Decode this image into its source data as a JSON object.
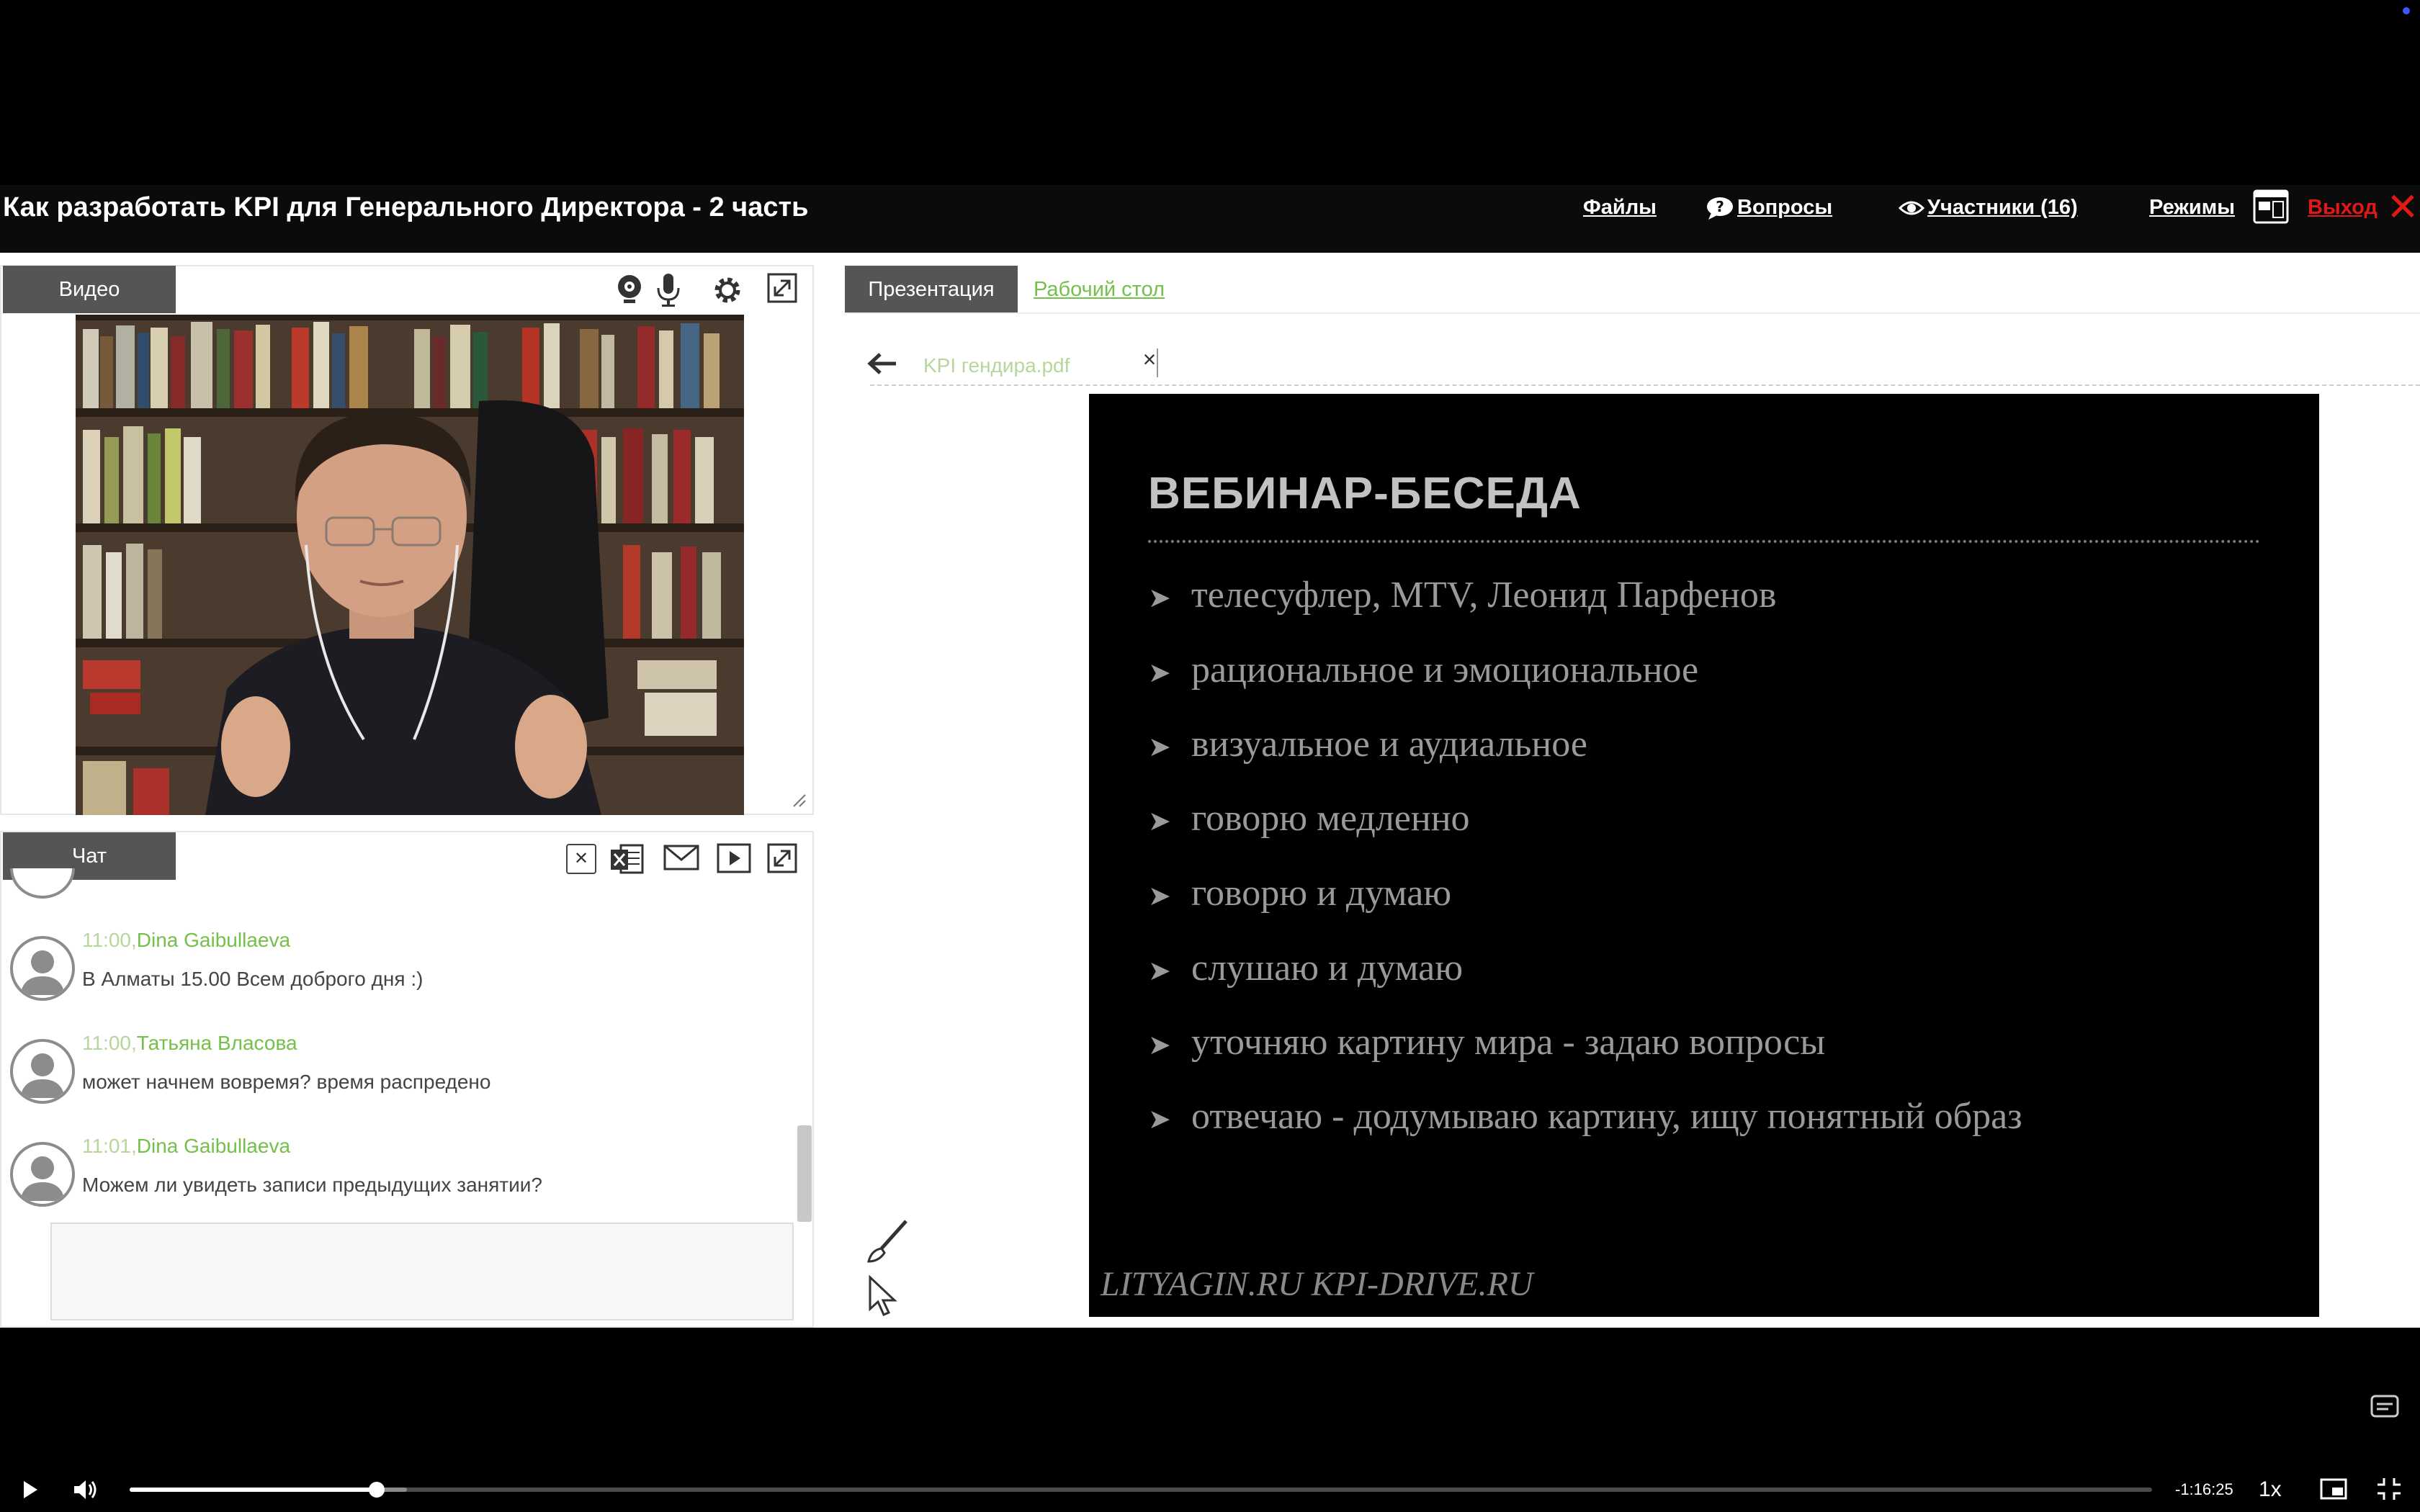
{
  "header": {
    "title": "Как разработать KPI для Генерального Директора - 2 часть",
    "links": {
      "files": "Файлы",
      "questions": "Вопросы",
      "participants": "Участники (16)",
      "modes": "Режимы",
      "exit": "Выход"
    },
    "close_glyph": "✕"
  },
  "video_panel": {
    "tab_label": "Видео",
    "tools": [
      "webcam-icon",
      "microphone-icon",
      "gear-icon",
      "expand-icon"
    ]
  },
  "chat_panel": {
    "tab_label": "Чат",
    "tools": [
      "clear-icon",
      "excel-export-icon",
      "mail-icon",
      "play-icon",
      "expand-icon"
    ],
    "messages": [
      {
        "time": "11:00,",
        "author": "Dina Gaibullaeva",
        "text": "В Алматы 15.00 Всем доброго дня :)"
      },
      {
        "time": "11:00,",
        "author": "Татьяна Власова",
        "text": "может начнем вовремя? время распредено"
      },
      {
        "time": "11:01,",
        "author": "Dina Gaibullaeva",
        "text": "Можем ли увидеть записи предыдущих занятии?"
      }
    ],
    "input_placeholder": ""
  },
  "presentation_panel": {
    "tab_label": "Презентация",
    "desktop_link": "Рабочий стол",
    "file_name": "KPI гендира.pdf",
    "file_close": "×",
    "slide": {
      "title": "ВЕБИНАР-БЕСЕДА",
      "bullets": [
        "телесуфлер, MTV, Леонид Парфенов",
        "рациональное и эмоциональное",
        "визуальное и аудиальное",
        "говорю медленно",
        "говорю и думаю",
        "слушаю и думаю",
        "уточняю картину мира - задаю вопросы",
        "отвечаю - додумываю картину, ищу понятный образ"
      ],
      "footer": "LITYAGIN.RU  KPI-DRIVE.RU"
    }
  },
  "player": {
    "progress_fraction": 0.122,
    "time_remaining": "-1:16:25",
    "speed": "1x",
    "icons": [
      "play-icon",
      "volume-icon",
      "captions-icon",
      "picture-in-picture-icon",
      "exit-fullscreen-icon"
    ]
  },
  "colors": {
    "accent_green": "#74c04a",
    "exit_red": "#e01818",
    "tab_gray": "#555555"
  }
}
